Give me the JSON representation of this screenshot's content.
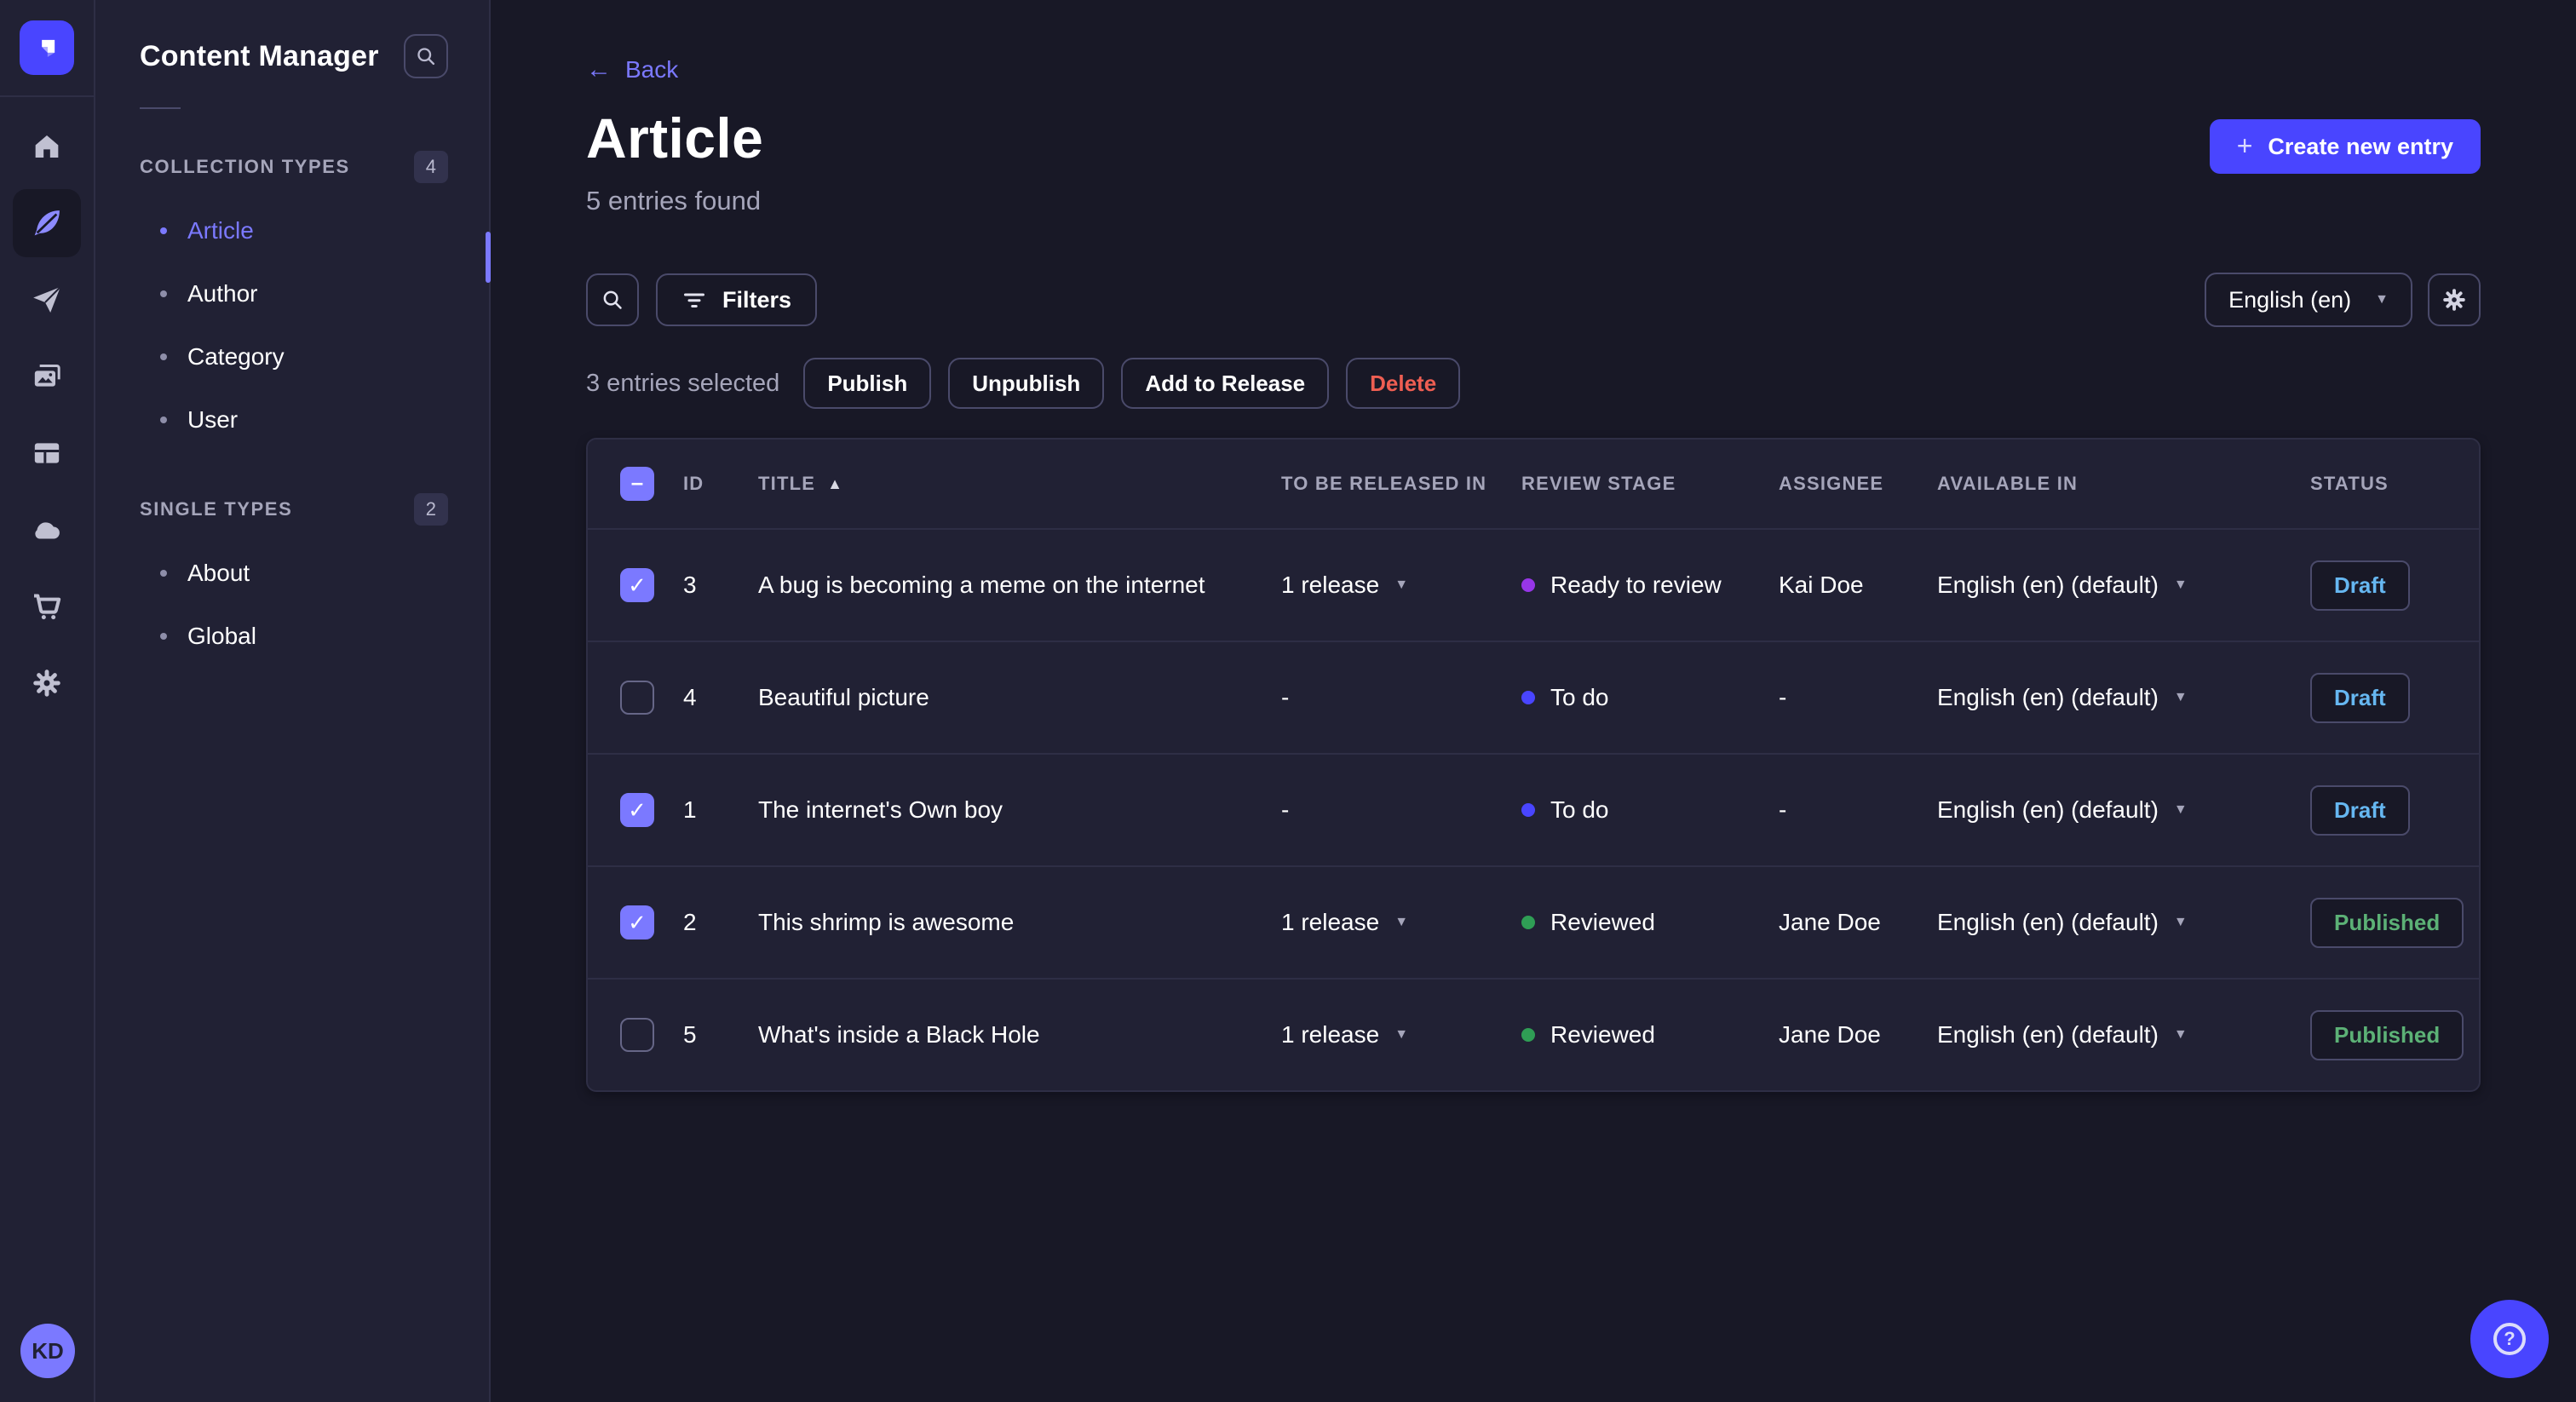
{
  "brand": {
    "name": "Strapi",
    "logo_color": "#4945ff"
  },
  "rail": {
    "items": [
      {
        "icon": "home-icon",
        "active": false
      },
      {
        "icon": "content-manager-feather-icon",
        "active": true
      },
      {
        "icon": "releases-paper-plane-icon",
        "active": false
      },
      {
        "icon": "media-library-images-icon",
        "active": false
      },
      {
        "icon": "content-type-builder-layout-icon",
        "active": false
      },
      {
        "icon": "deploy-cloud-icon",
        "active": false
      },
      {
        "icon": "marketplace-cart-icon",
        "active": false
      },
      {
        "icon": "settings-gear-icon",
        "active": false
      }
    ],
    "avatar_initials": "KD"
  },
  "sidebar": {
    "title": "Content Manager",
    "search_icon": "search-icon",
    "sections": [
      {
        "label": "COLLECTION TYPES",
        "badge": "4",
        "items": [
          {
            "label": "Article",
            "active": true
          },
          {
            "label": "Author"
          },
          {
            "label": "Category"
          },
          {
            "label": "User"
          }
        ]
      },
      {
        "label": "SINGLE TYPES",
        "badge": "2",
        "items": [
          {
            "label": "About"
          },
          {
            "label": "Global"
          }
        ]
      }
    ]
  },
  "header": {
    "back_label": "Back",
    "title": "Article",
    "subtitle": "5 entries found",
    "create_button_label": "Create new entry"
  },
  "toolbar": {
    "filters_label": "Filters",
    "locale_value": "English (en)"
  },
  "selection": {
    "summary": "3 entries selected",
    "publish_label": "Publish",
    "unpublish_label": "Unpublish",
    "add_to_release_label": "Add to Release",
    "delete_label": "Delete"
  },
  "table": {
    "header_checkbox": "indeterminate",
    "columns": {
      "id": "ID",
      "title": "TITLE",
      "released": "TO BE RELEASED IN",
      "stage": "REVIEW STAGE",
      "assignee": "ASSIGNEE",
      "available": "AVAILABLE IN",
      "status": "STATUS"
    },
    "sort_column": "TITLE",
    "sort_direction": "asc",
    "rows": [
      {
        "checked": true,
        "id": "3",
        "title": "A bug is becoming a meme on the internet",
        "released": "1 release",
        "stage": "Ready to review",
        "stage_color": "#9736e8",
        "assignee": "Kai Doe",
        "available": "English (en) (default)",
        "status": "Draft",
        "status_color": "#66b7f1"
      },
      {
        "checked": false,
        "id": "4",
        "title": "Beautiful picture",
        "released": "-",
        "stage": "To do",
        "stage_color": "#4945ff",
        "assignee": "-",
        "available": "English (en) (default)",
        "status": "Draft",
        "status_color": "#66b7f1"
      },
      {
        "checked": true,
        "id": "1",
        "title": "The internet's Own boy",
        "released": "-",
        "stage": "To do",
        "stage_color": "#4945ff",
        "assignee": "-",
        "available": "English (en) (default)",
        "status": "Draft",
        "status_color": "#66b7f1"
      },
      {
        "checked": true,
        "id": "2",
        "title": "This shrimp is awesome",
        "released": "1 release",
        "stage": "Reviewed",
        "stage_color": "#2f9e55",
        "assignee": "Jane Doe",
        "available": "English (en) (default)",
        "status": "Published",
        "status_color": "#5cb176"
      },
      {
        "checked": false,
        "id": "5",
        "title": "What's inside a Black Hole",
        "released": "1 release",
        "stage": "Reviewed",
        "stage_color": "#2f9e55",
        "assignee": "Jane Doe",
        "available": "English (en) (default)",
        "status": "Published",
        "status_color": "#5cb176"
      }
    ]
  },
  "colors": {
    "primary": "#4945ff",
    "primary_light": "#7b79ff",
    "danger": "#ee5e52",
    "draft": "#66b7f1",
    "published": "#5cb176",
    "stage_todo": "#4945ff",
    "stage_ready_to_review": "#9736e8",
    "stage_reviewed": "#2f9e55"
  },
  "help": {
    "icon": "help-question-icon"
  }
}
